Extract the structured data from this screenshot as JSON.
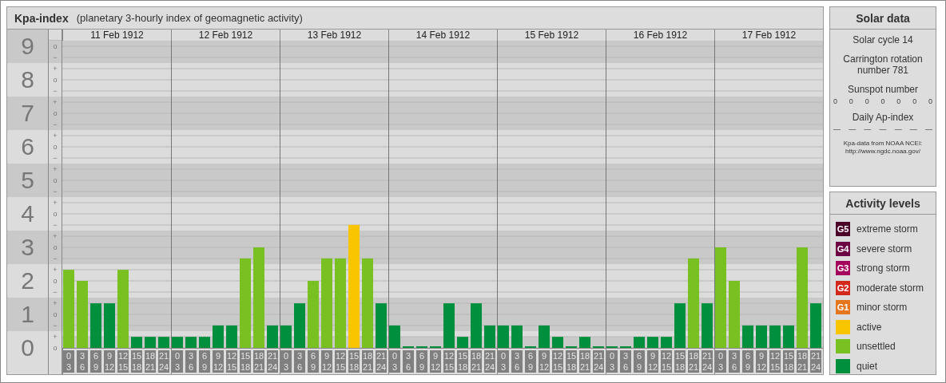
{
  "header": {
    "title": "Kpa-index",
    "subtitle": "(planetary 3-hourly index of geomagnetic activity)"
  },
  "chart": {
    "days": [
      "11 Feb 1912",
      "12 Feb 1912",
      "13 Feb 1912",
      "14 Feb 1912",
      "15 Feb 1912",
      "16 Feb 1912",
      "17 Feb 1912"
    ],
    "sub_ticks": [
      "o",
      "−",
      "+",
      "o",
      "−",
      "+",
      "o",
      "−",
      "+",
      "o",
      "−",
      "+",
      "o",
      "−",
      "+",
      "o",
      "−",
      "+",
      "o",
      "−",
      "+",
      "o",
      "−",
      "+",
      "o",
      "−",
      "+",
      "o"
    ],
    "chart_data": {
      "type": "bar",
      "stacked": true,
      "grid": true,
      "ylim": [
        0,
        9
      ],
      "yticks": [
        9,
        8,
        7,
        6,
        5,
        4,
        3,
        2,
        1,
        0
      ],
      "categories": [
        "0 3",
        "3 6",
        "6 9",
        "9 12",
        "12 15",
        "15 18",
        "18 21",
        "21 24",
        "0 3",
        "3 6",
        "6 9",
        "9 12",
        "12 15",
        "15 18",
        "18 21",
        "21 24",
        "0 3",
        "3 6",
        "6 9",
        "9 12",
        "12 15",
        "15 18",
        "18 21",
        "21 24",
        "0 3",
        "3 6",
        "6 9",
        "9 12",
        "12 15",
        "15 18",
        "18 21",
        "21 24",
        "0 3",
        "3 6",
        "6 9",
        "9 12",
        "12 15",
        "15 18",
        "18 21",
        "21 24",
        "0 3",
        "3 6",
        "6 9",
        "9 12",
        "12 15",
        "15 18",
        "18 21",
        "21 24",
        "0 3",
        "3 6",
        "6 9",
        "9 12",
        "12 15",
        "15 18",
        "18 21",
        "21 24"
      ],
      "series": [
        {
          "name": "quiet",
          "color": "#008f3c",
          "values": [
            null,
            null,
            1.33,
            1.33,
            null,
            0.33,
            0.33,
            0.33,
            0.33,
            0.33,
            0.33,
            0.67,
            0.67,
            null,
            null,
            0.67,
            0.67,
            1.33,
            null,
            null,
            null,
            null,
            null,
            1.33,
            0.67,
            0,
            0,
            0,
            1.33,
            0.33,
            1.33,
            0.67,
            0.67,
            0.67,
            0,
            0.67,
            0.33,
            0,
            0.33,
            0,
            0,
            0,
            0.33,
            0.33,
            0.33,
            1.33,
            null,
            1.33,
            null,
            null,
            0.67,
            0.67,
            0.67,
            0.67,
            null,
            1.33
          ]
        },
        {
          "name": "unsettled",
          "color": "#79c121",
          "values": [
            2.33,
            2,
            null,
            null,
            2.33,
            null,
            null,
            null,
            null,
            null,
            null,
            null,
            null,
            2.67,
            3,
            null,
            null,
            null,
            2,
            2.67,
            2.67,
            null,
            2.67,
            null,
            null,
            null,
            null,
            null,
            null,
            null,
            null,
            null,
            null,
            null,
            null,
            null,
            null,
            null,
            null,
            null,
            null,
            null,
            null,
            null,
            null,
            null,
            2.67,
            null,
            3,
            2,
            null,
            null,
            null,
            null,
            3,
            null
          ]
        },
        {
          "name": "active",
          "color": "#f9c500",
          "values": [
            null,
            null,
            null,
            null,
            null,
            null,
            null,
            null,
            null,
            null,
            null,
            null,
            null,
            null,
            null,
            null,
            null,
            null,
            null,
            null,
            null,
            3.67,
            null,
            null,
            null,
            null,
            null,
            null,
            null,
            null,
            null,
            null,
            null,
            null,
            null,
            null,
            null,
            null,
            null,
            null,
            null,
            null,
            null,
            null,
            null,
            null,
            null,
            null,
            null,
            null,
            null,
            null,
            null,
            null,
            null,
            null
          ]
        }
      ]
    }
  },
  "solar": {
    "title": "Solar data",
    "cycle": "Solar cycle 14",
    "rotation": "Carrington rotation number 781",
    "sunspot_label": "Sunspot number",
    "sunspots": [
      "0",
      "0",
      "0",
      "0",
      "0",
      "0",
      "0"
    ],
    "ap_label": "Daily Ap-index",
    "ap_values": [
      "—",
      "—",
      "—",
      "—",
      "—",
      "—",
      "—"
    ],
    "source_note": "Kpa-data from NOAA NCEI:",
    "source_url": "http://www.ngdc.noaa.gov/"
  },
  "legend": {
    "title": "Activity levels",
    "items": [
      {
        "badge": "G5",
        "label": "extreme storm",
        "color": "#4a0028"
      },
      {
        "badge": "G4",
        "label": "severe storm",
        "color": "#6c0042"
      },
      {
        "badge": "G3",
        "label": "strong storm",
        "color": "#a4005c"
      },
      {
        "badge": "G2",
        "label": "moderate storm",
        "color": "#d3291d"
      },
      {
        "badge": "G1",
        "label": "minor storm",
        "color": "#e5761c"
      }
    ]
  }
}
